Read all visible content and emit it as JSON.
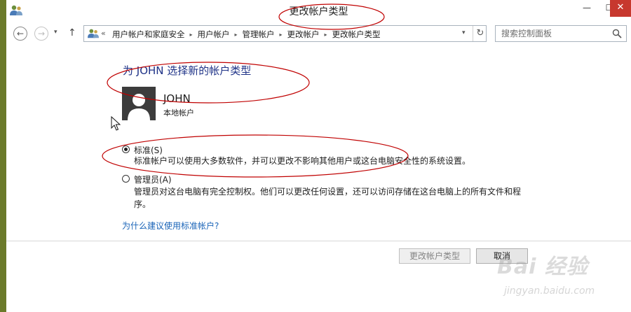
{
  "window": {
    "title": "更改帐户类型",
    "controls": {
      "minimize": "—",
      "maximize": "☐",
      "close": "✕"
    }
  },
  "nav": {
    "back": "←",
    "forward": "→",
    "recent": "▾",
    "up": "↑",
    "address_prefix": "«",
    "breadcrumbs": [
      "用户帐户和家庭安全",
      "用户帐户",
      "管理帐户",
      "更改帐户",
      "更改帐户类型"
    ],
    "separator": "▸",
    "dropdown": "▾",
    "refresh": "↻",
    "search_placeholder": "搜索控制面板"
  },
  "main": {
    "heading": "为 JOHN 选择新的帐户类型",
    "user": {
      "name": "JOHN",
      "type": "本地帐户"
    },
    "options": [
      {
        "label": "标准(S)",
        "checked": true,
        "description": "标准帐户可以使用大多数软件，并可以更改不影响其他用户或这台电脑安全性的系统设置。"
      },
      {
        "label": "管理员(A)",
        "checked": false,
        "description_line1": "管理员对这台电脑有完全控制权。他们可以更改任何设置，还可以访问存储在这台电脑上的所有文件和程",
        "description_line2": "序。"
      }
    ],
    "help_link": "为什么建议使用标准帐户?"
  },
  "footer": {
    "primary_button": "更改帐户类型",
    "cancel_button": "取消"
  },
  "watermark": {
    "logo_text": "Bai 经验",
    "url": "jingyan.baidu.com"
  },
  "colors": {
    "heading": "#1e3287",
    "link": "#1a64b8",
    "close_button": "#c7382e",
    "annotation": "#c00000"
  }
}
